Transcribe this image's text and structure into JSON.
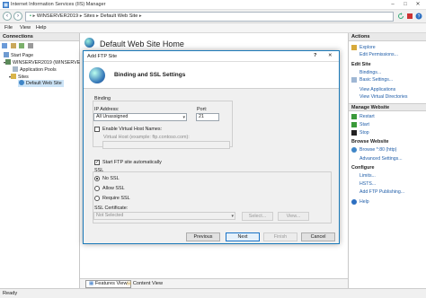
{
  "window": {
    "title": "Internet Information Services (IIS) Manager"
  },
  "address": {
    "segments": [
      "WINSERVER2019",
      "Sites",
      "Default Web Site"
    ]
  },
  "menu": {
    "file": "File",
    "view": "View",
    "help": "Help"
  },
  "connections": {
    "header": "Connections",
    "tree": [
      "Start Page",
      "WINSERVER2019 (WINSERVER",
      "Application Pools",
      "Sites",
      "Default Web Site"
    ]
  },
  "center": {
    "title": "Default Web Site Home"
  },
  "actions": {
    "header": "Actions",
    "explore": "Explore",
    "edit_permissions": "Edit Permissions...",
    "edit_site_header": "Edit Site",
    "bindings": "Bindings...",
    "basic_settings": "Basic Settings...",
    "view_applications": "View Applications",
    "view_virtual_directories": "View Virtual Directories",
    "manage_website_header": "Manage Website",
    "restart": "Restart",
    "start": "Start",
    "stop": "Stop",
    "browse_website_header": "Browse Website",
    "browse_80": "Browse *:80 (http)",
    "advanced_settings": "Advanced Settings...",
    "configure_header": "Configure",
    "limits": "Limits...",
    "hsts": "HSTS...",
    "add_ftp_publishing": "Add FTP Publishing...",
    "help": "Help"
  },
  "bottom_tabs": {
    "features": "Features View",
    "content": "Content View"
  },
  "status": {
    "text": "Ready"
  },
  "dialog": {
    "title": "Add FTP Site",
    "heading": "Binding and SSL Settings",
    "binding_group": "Binding",
    "ip_label": "IP Address:",
    "ip_value": "All Unassigned",
    "port_label": "Port:",
    "port_value": "21",
    "enable_vhost": "Enable Virtual Host Names:",
    "vhost_placeholder": "Virtual Host (example: ftp.contoso.com):",
    "auto_start": "Start FTP site automatically",
    "ssl_group": "SSL",
    "no_ssl": "No SSL",
    "allow_ssl": "Allow SSL",
    "require_ssl": "Require SSL",
    "ssl_cert_label": "SSL Certificate:",
    "ssl_cert_value": "Not Selected",
    "select_btn": "Select...",
    "view_btn": "View...",
    "previous_btn": "Previous",
    "next_btn": "Next",
    "finish_btn": "Finish",
    "cancel_btn": "Cancel",
    "help_icon_label": "?"
  },
  "colors": {
    "accent": "#1b7ab9",
    "link": "#1f5da8"
  }
}
